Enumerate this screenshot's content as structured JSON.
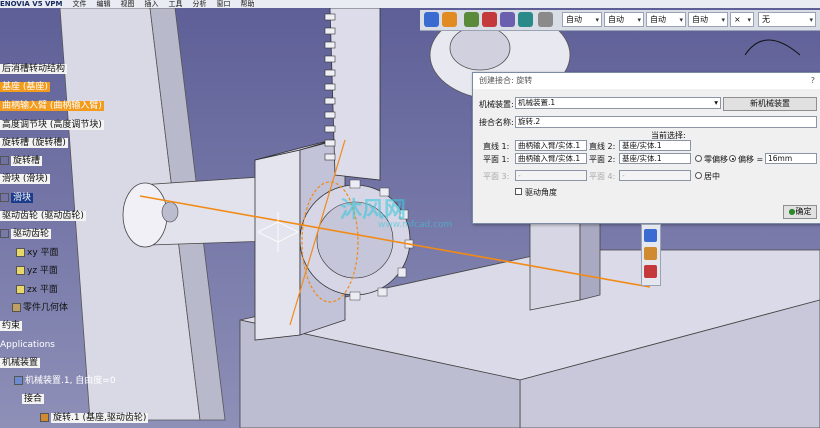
{
  "menubar": {
    "app_title": "ENOVIA V5 VPM",
    "items": [
      "文件",
      "编辑",
      "视图",
      "插入",
      "工具",
      "分析",
      "窗口",
      "帮助"
    ]
  },
  "toolbar": {
    "selects": [
      "自动",
      "自动",
      "自动",
      "自动",
      "无"
    ],
    "x_select": "×"
  },
  "tree": {
    "root": "后消槽转动结构",
    "items": [
      {
        "label": "基座 (基座)",
        "style": "orange"
      },
      {
        "label": "曲柄输入臂 (曲柄输入臂)",
        "style": "orange"
      },
      {
        "label": "高度调节块 (高度调节块)",
        "style": "white"
      },
      {
        "label": "旋转槽 (旋转槽)",
        "style": "white"
      },
      {
        "label": "旋转槽",
        "style": "white"
      },
      {
        "label": "滑块 (滑块)",
        "style": "white"
      },
      {
        "label": "滑块",
        "style": "blue"
      },
      {
        "label": "驱动齿轮 (驱动齿轮)",
        "style": "white"
      },
      {
        "label": "驱动齿轮",
        "style": "white"
      },
      {
        "label": "xy 平面",
        "style": "plain"
      },
      {
        "label": "yz 平面",
        "style": "plain"
      },
      {
        "label": "zx 平面",
        "style": "plain"
      },
      {
        "label": "零件几何体",
        "style": "plain"
      },
      {
        "label": "约束",
        "style": "white"
      },
      {
        "label": "Applications",
        "style": "plain"
      },
      {
        "label": "机械装置",
        "style": "white"
      },
      {
        "label": "机械装置.1, 自由度=0",
        "style": "plain"
      },
      {
        "label": "接合",
        "style": "white"
      },
      {
        "label": "旋转.1 (基座,驱动齿轮)",
        "style": "white"
      }
    ]
  },
  "watermark": {
    "text": "沐风网",
    "url": "www.mfcad.com"
  },
  "dialog": {
    "title": "创建接合: 旋转",
    "help": "?",
    "mechanism_label": "机械装置:",
    "mechanism_value": "机械装置.1",
    "new_mechanism_button": "新机械装置",
    "joint_name_label": "接合名称:",
    "joint_name_value": "旋转.2",
    "current_selection": "当前选择:",
    "line1_label": "直线 1:",
    "line1_value": "曲柄输入臂/实体.1",
    "line2_label": "直线 2:",
    "line2_value": "基座/实体.1",
    "plane1_label": "平面 1:",
    "plane1_value": "曲柄输入臂/实体.1",
    "plane2_label": "平面 2:",
    "plane2_value": "基座/实体.1",
    "plane3_label": "平面 3:",
    "plane3_value": "-",
    "plane4_label": "平面 4:",
    "plane4_value": "-",
    "zero_offset_label": "零偏移",
    "offset_label": "偏移 =",
    "offset_value": "16mm",
    "centered_label": "居中",
    "drive_angle_label": "驱动角度",
    "ok_button": "确定",
    "offset_selected": true
  },
  "colors": {
    "background": "#6f73a8",
    "part_gray": "#e3e3ee",
    "axis_orange": "#f28a16",
    "tree_orange": "#f39b1c",
    "tree_blue": "#1c3d8c"
  }
}
